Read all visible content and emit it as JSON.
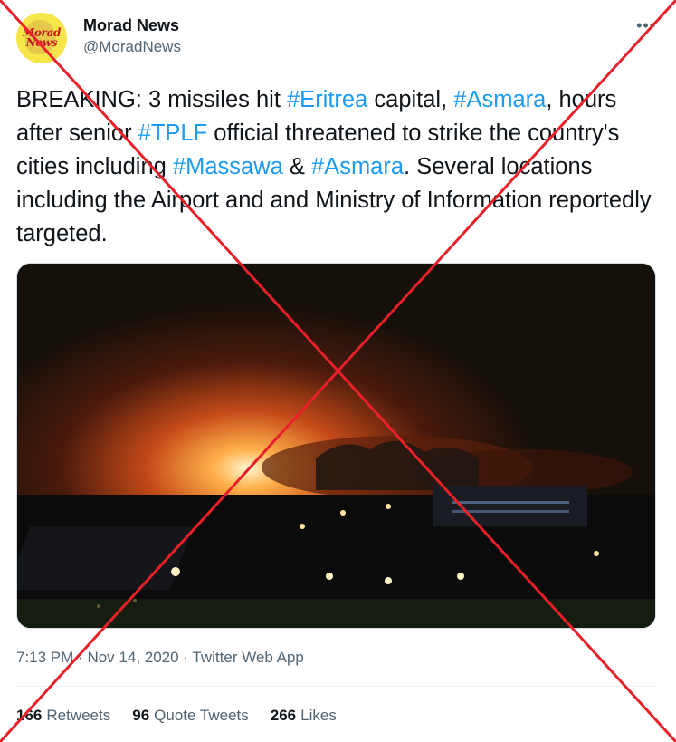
{
  "author": {
    "name": "Morad News",
    "handle": "@MoradNews",
    "avatar_text_line1": "Morad",
    "avatar_text_line2": "News"
  },
  "more_icon": "more-horizontal-icon",
  "tweet": {
    "segments": [
      {
        "text": "BREAKING: 3 missiles hit ",
        "type": "text"
      },
      {
        "text": "#Eritrea",
        "type": "hashtag"
      },
      {
        "text": " capital, ",
        "type": "text"
      },
      {
        "text": "#Asmara",
        "type": "hashtag"
      },
      {
        "text": ", hours after senior ",
        "type": "text"
      },
      {
        "text": "#TPLF",
        "type": "hashtag"
      },
      {
        "text": " official threatened to strike the country's cities including ",
        "type": "text"
      },
      {
        "text": "#Massawa",
        "type": "hashtag"
      },
      {
        "text": " & ",
        "type": "text"
      },
      {
        "text": "#Asmara",
        "type": "hashtag"
      },
      {
        "text": ". Several locations including the Airport and and Ministry of Information reportedly targeted.",
        "type": "text"
      }
    ]
  },
  "meta": {
    "time": "7:13 PM",
    "separator": "·",
    "date": "Nov 14, 2020",
    "source": "Twitter Web App"
  },
  "stats": {
    "retweets_count": "166",
    "retweets_label": "Retweets",
    "quotes_count": "96",
    "quotes_label": "Quote Tweets",
    "likes_count": "266",
    "likes_label": "Likes"
  },
  "colors": {
    "hashtag": "#1d9bf0",
    "cross": "#e8202a",
    "secondary_text": "#536471"
  }
}
